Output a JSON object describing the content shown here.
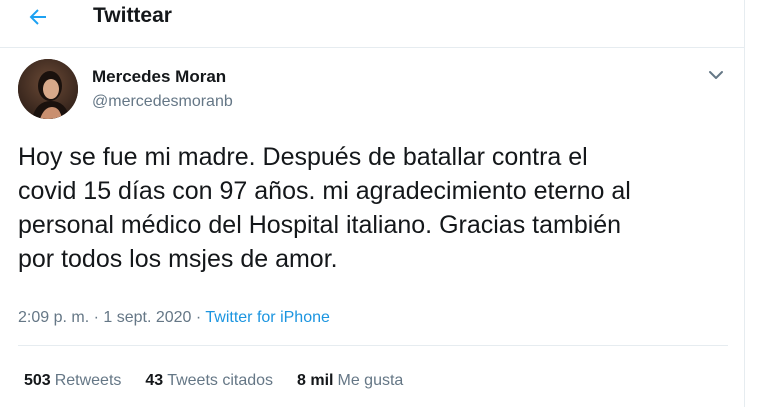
{
  "header": {
    "title": "Twittear",
    "back_icon": "arrow-left-icon"
  },
  "colors": {
    "accent": "#1da1f2",
    "link": "#1b95e0",
    "secondary_text": "#657786",
    "primary_text": "#14171a",
    "divider": "#e6ecf0"
  },
  "author": {
    "name": "Mercedes Moran",
    "handle": "@mercedesmoranb",
    "avatar_icon": "profile-photo",
    "menu_icon": "chevron-down-icon"
  },
  "tweet": {
    "text": "Hoy se fue mi madre. Después de batallar contra el\ncovid 15 días con 97 años. mi agradecimiento eterno al\npersonal médico del Hospital italiano. Gracias también\npor todos los msjes de amor."
  },
  "meta": {
    "time": "2:09 p. m.",
    "separator": " · ",
    "date": "1 sept. 2020",
    "source": "Twitter for iPhone"
  },
  "stats": {
    "retweets_count": "503",
    "retweets_label": "Retweets",
    "quotes_count": "43",
    "quotes_label": "Tweets citados",
    "likes_count": "8 mil",
    "likes_label": "Me gusta"
  }
}
